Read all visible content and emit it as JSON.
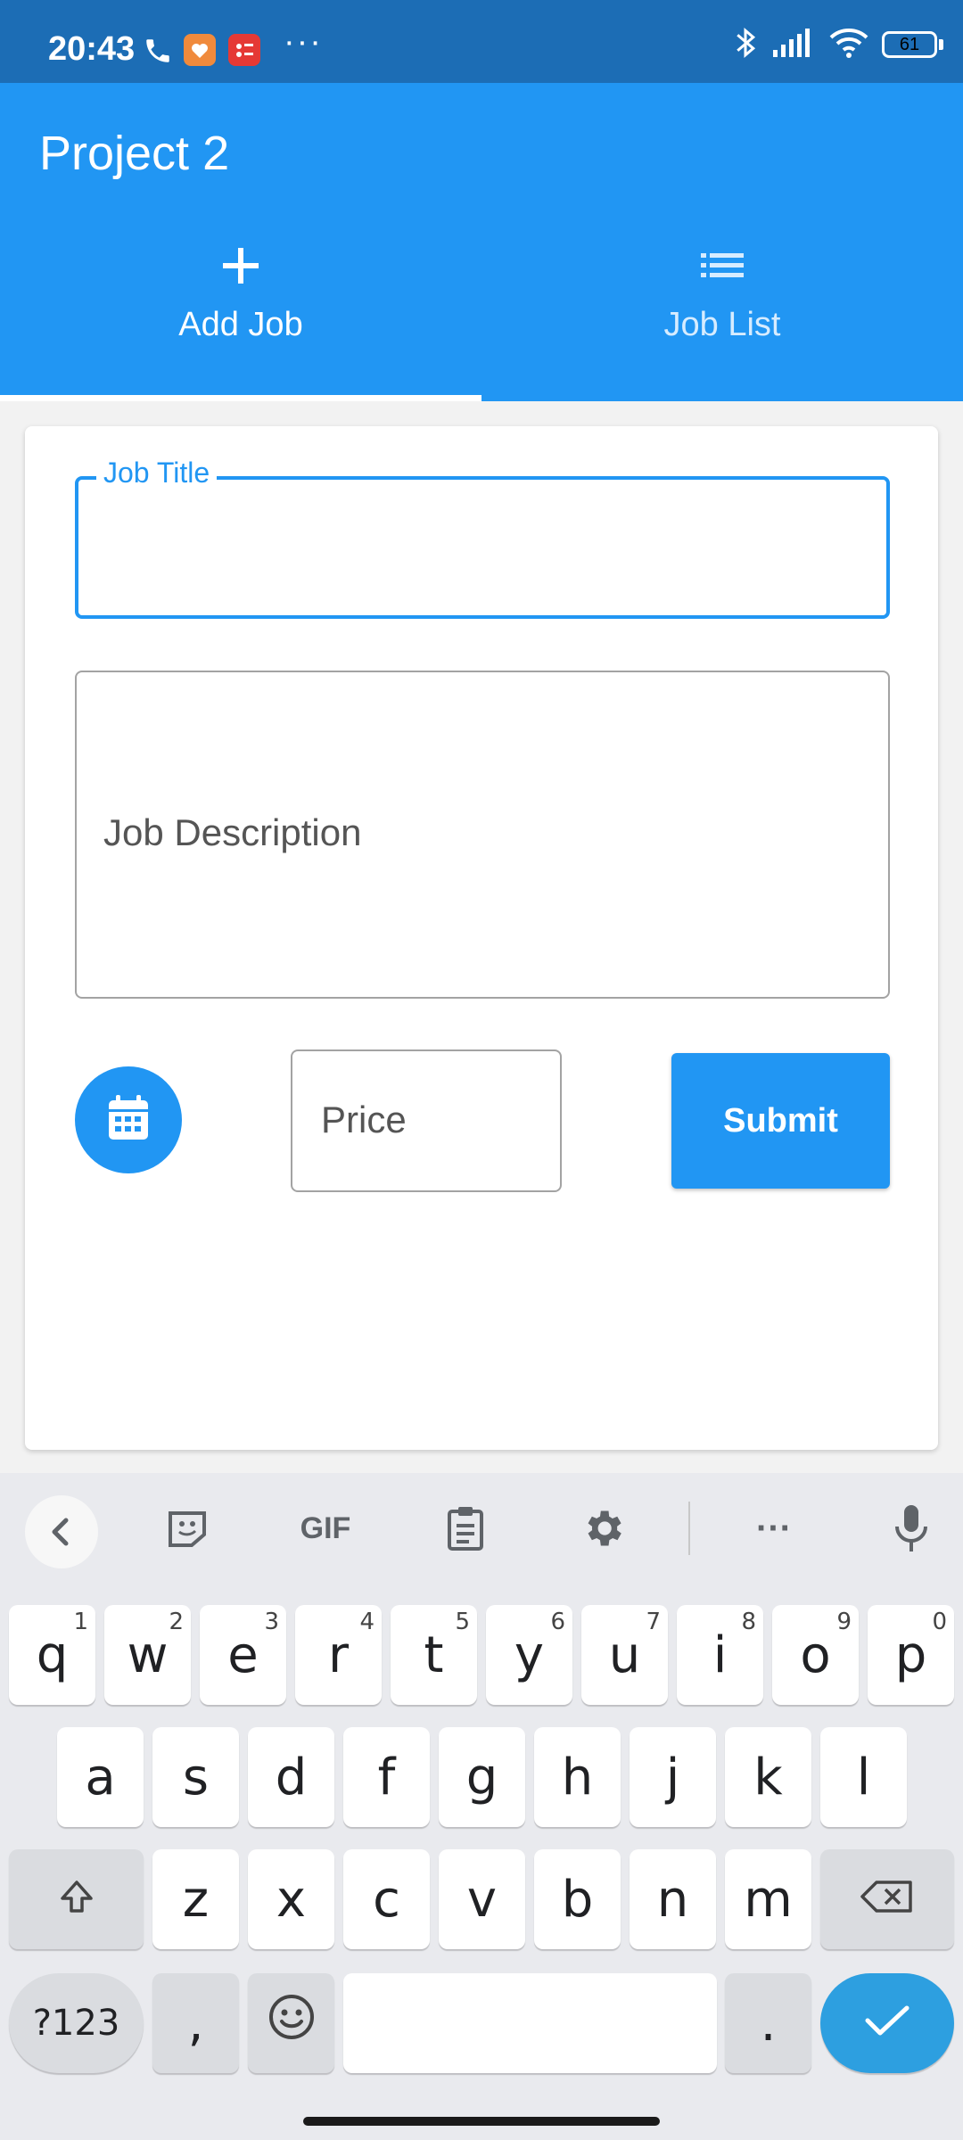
{
  "status_bar": {
    "time": "20:43",
    "dots": "···",
    "battery": "61",
    "icons": [
      "phone-icon",
      "orange-app-icon",
      "red-app-icon",
      "bluetooth-icon",
      "signal-icon",
      "wifi-icon",
      "battery-icon"
    ]
  },
  "app": {
    "title": "Project 2",
    "tabs": [
      {
        "label": "Add Job",
        "icon": "plus-icon",
        "selected": true
      },
      {
        "label": "Job List",
        "icon": "list-icon",
        "selected": false
      }
    ],
    "colors": {
      "primary": "#2196f3",
      "status_bar": "#1c6db5"
    }
  },
  "form": {
    "job_title_label": "Job Title",
    "job_title_value": "",
    "job_description_placeholder": "Job Description",
    "price_placeholder": "Price",
    "submit_label": "Submit",
    "calendar_icon": "calendar-icon"
  },
  "keyboard": {
    "toolbar": {
      "gif_label": "GIF",
      "more_label": "···"
    },
    "row1": [
      {
        "k": "q",
        "h": "1"
      },
      {
        "k": "w",
        "h": "2"
      },
      {
        "k": "e",
        "h": "3"
      },
      {
        "k": "r",
        "h": "4"
      },
      {
        "k": "t",
        "h": "5"
      },
      {
        "k": "y",
        "h": "6"
      },
      {
        "k": "u",
        "h": "7"
      },
      {
        "k": "i",
        "h": "8"
      },
      {
        "k": "o",
        "h": "9"
      },
      {
        "k": "p",
        "h": "0"
      }
    ],
    "row2": [
      "a",
      "s",
      "d",
      "f",
      "g",
      "h",
      "j",
      "k",
      "l"
    ],
    "row3": [
      "z",
      "x",
      "c",
      "v",
      "b",
      "n",
      "m"
    ],
    "symbols_label": "?123",
    "comma": ",",
    "period": "."
  }
}
